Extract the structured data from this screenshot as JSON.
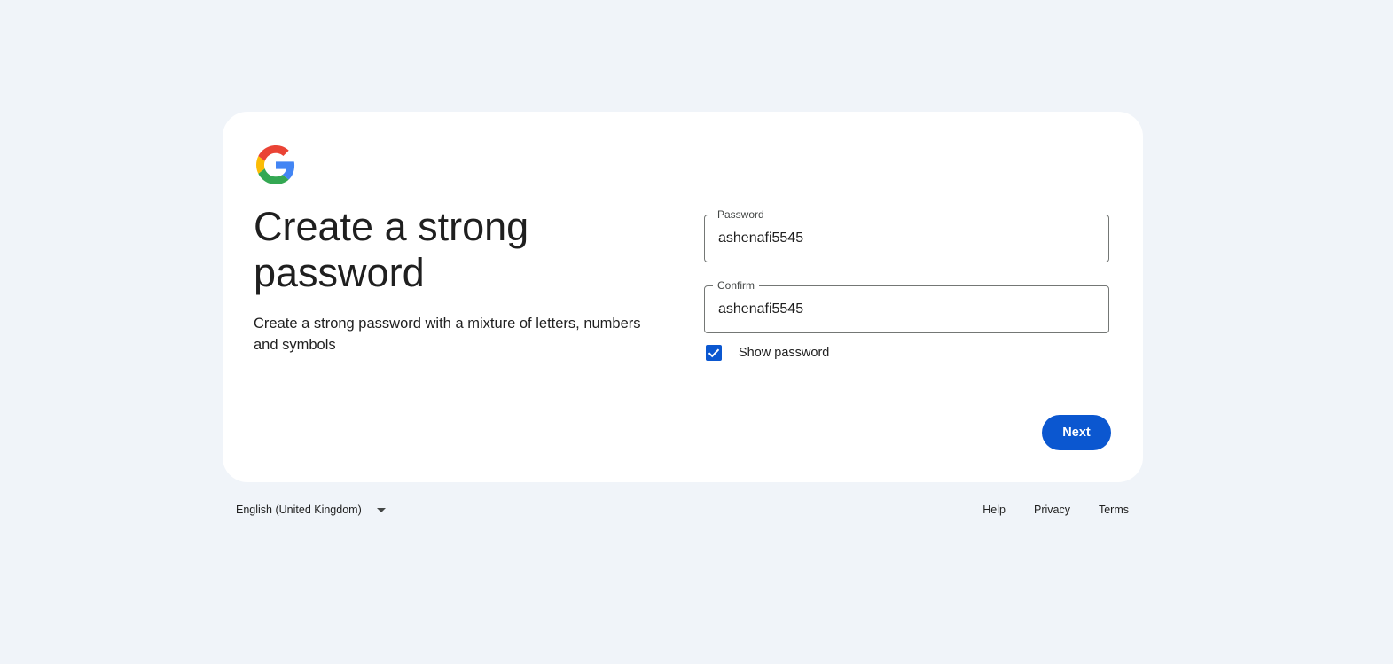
{
  "card": {
    "title": "Create a strong password",
    "subtitle": "Create a strong password with a mixture of letters, numbers and symbols",
    "logo_icon": "google-g-icon"
  },
  "form": {
    "password_label": "Password",
    "password_value": "ashenafi5545",
    "confirm_label": "Confirm",
    "confirm_value": "ashenafi5545",
    "show_password_label": "Show password",
    "show_password_checked": true,
    "next_label": "Next"
  },
  "footer": {
    "language": "English (United Kingdom)",
    "links": [
      "Help",
      "Privacy",
      "Terms"
    ]
  },
  "colors": {
    "background": "#f0f4f9",
    "card": "#ffffff",
    "accent": "#0b57d0",
    "text": "#1f1f1f"
  }
}
